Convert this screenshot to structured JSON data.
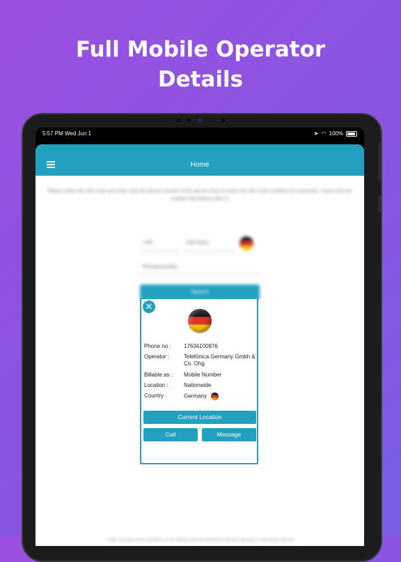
{
  "headline": {
    "line1": "Full Mobile Operator",
    "line2": "Details"
  },
  "status_bar": {
    "time": "5:57 PM  Wed Jun 1",
    "battery": "100%"
  },
  "navbar": {
    "title": "Home"
  },
  "background_form": {
    "description": "Please select the ISD code and enter only the phone number of the person then to reach the ISD code numbers as instruction. Insert only the number that follows after 0.",
    "isd_code": "+49",
    "country": "Germany",
    "phone_placeholder": "Phonenumber",
    "search_label": "Search"
  },
  "footer_text": "* Note: Actually these operators is the details with the ported/non-ported operator of the phone number",
  "result_card": {
    "fields": [
      {
        "label": "Phone no :",
        "value": "17634100876"
      },
      {
        "label": "Operator :",
        "value": "Telefónica Germany Gmbh & Co. Ohg"
      },
      {
        "label": "Billable as :",
        "value": "Mobile Number"
      },
      {
        "label": "Location :",
        "value": "Nationwide"
      },
      {
        "label": "Country :",
        "value": "Germany"
      }
    ],
    "current_location_label": "Current Location",
    "call_label": "Call",
    "message_label": "Message"
  },
  "colors": {
    "accent": "#23a0bf",
    "background_start": "#9b4fe0",
    "background_end": "#7a5ee6"
  }
}
